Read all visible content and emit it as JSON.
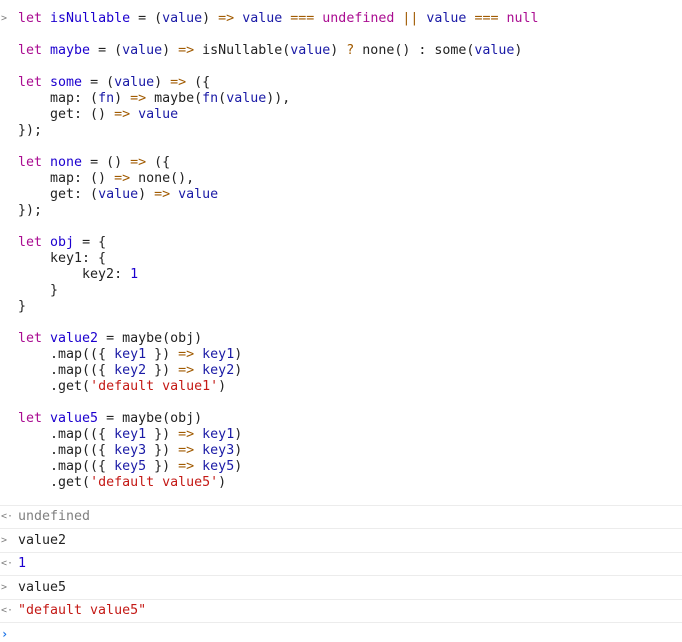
{
  "console": {
    "input_block": {
      "lines": [
        [
          [
            "kw",
            "let "
          ],
          [
            "var",
            "isNullable"
          ],
          [
            "plain",
            " = ("
          ],
          [
            "varb",
            "value"
          ],
          [
            "plain",
            ") "
          ],
          [
            "op",
            "=>"
          ],
          [
            "plain",
            " "
          ],
          [
            "varb",
            "value"
          ],
          [
            "plain",
            " "
          ],
          [
            "op",
            "==="
          ],
          [
            "plain",
            " "
          ],
          [
            "kw",
            "undefined"
          ],
          [
            "plain",
            " "
          ],
          [
            "op",
            "||"
          ],
          [
            "plain",
            " "
          ],
          [
            "varb",
            "value"
          ],
          [
            "plain",
            " "
          ],
          [
            "op",
            "==="
          ],
          [
            "plain",
            " "
          ],
          [
            "kw",
            "null"
          ]
        ],
        [],
        [
          [
            "kw",
            "let "
          ],
          [
            "var",
            "maybe"
          ],
          [
            "plain",
            " = ("
          ],
          [
            "varb",
            "value"
          ],
          [
            "plain",
            ") "
          ],
          [
            "op",
            "=>"
          ],
          [
            "plain",
            " isNullable("
          ],
          [
            "varb",
            "value"
          ],
          [
            "plain",
            ") "
          ],
          [
            "op",
            "?"
          ],
          [
            "plain",
            " none() : some("
          ],
          [
            "varb",
            "value"
          ],
          [
            "plain",
            ")"
          ]
        ],
        [],
        [
          [
            "kw",
            "let "
          ],
          [
            "var",
            "some"
          ],
          [
            "plain",
            " = ("
          ],
          [
            "varb",
            "value"
          ],
          [
            "plain",
            ") "
          ],
          [
            "op",
            "=>"
          ],
          [
            "plain",
            " ({"
          ]
        ],
        [
          [
            "plain",
            "    map: ("
          ],
          [
            "varb",
            "fn"
          ],
          [
            "plain",
            ") "
          ],
          [
            "op",
            "=>"
          ],
          [
            "plain",
            " maybe("
          ],
          [
            "varb",
            "fn"
          ],
          [
            "plain",
            "("
          ],
          [
            "varb",
            "value"
          ],
          [
            "plain",
            ")),"
          ]
        ],
        [
          [
            "plain",
            "    get: () "
          ],
          [
            "op",
            "=>"
          ],
          [
            "plain",
            " "
          ],
          [
            "varb",
            "value"
          ]
        ],
        [
          [
            "plain",
            "});"
          ]
        ],
        [],
        [
          [
            "kw",
            "let "
          ],
          [
            "var",
            "none"
          ],
          [
            "plain",
            " = () "
          ],
          [
            "op",
            "=>"
          ],
          [
            "plain",
            " ({"
          ]
        ],
        [
          [
            "plain",
            "    map: () "
          ],
          [
            "op",
            "=>"
          ],
          [
            "plain",
            " none(),"
          ]
        ],
        [
          [
            "plain",
            "    get: ("
          ],
          [
            "varb",
            "value"
          ],
          [
            "plain",
            ") "
          ],
          [
            "op",
            "=>"
          ],
          [
            "plain",
            " "
          ],
          [
            "varb",
            "value"
          ]
        ],
        [
          [
            "plain",
            "});"
          ]
        ],
        [],
        [
          [
            "kw",
            "let "
          ],
          [
            "var",
            "obj"
          ],
          [
            "plain",
            " = {"
          ]
        ],
        [
          [
            "plain",
            "    key1: {"
          ]
        ],
        [
          [
            "plain",
            "        key2: "
          ],
          [
            "num",
            "1"
          ]
        ],
        [
          [
            "plain",
            "    }"
          ]
        ],
        [
          [
            "plain",
            "}"
          ]
        ],
        [],
        [
          [
            "kw",
            "let "
          ],
          [
            "var",
            "value2"
          ],
          [
            "plain",
            " = maybe(obj)"
          ]
        ],
        [
          [
            "plain",
            "    .map(({ "
          ],
          [
            "varb",
            "key1"
          ],
          [
            "plain",
            " }) "
          ],
          [
            "op",
            "=>"
          ],
          [
            "plain",
            " "
          ],
          [
            "varb",
            "key1"
          ],
          [
            "plain",
            ")"
          ]
        ],
        [
          [
            "plain",
            "    .map(({ "
          ],
          [
            "varb",
            "key2"
          ],
          [
            "plain",
            " }) "
          ],
          [
            "op",
            "=>"
          ],
          [
            "plain",
            " "
          ],
          [
            "varb",
            "key2"
          ],
          [
            "plain",
            ")"
          ]
        ],
        [
          [
            "plain",
            "    .get("
          ],
          [
            "str",
            "'default value1'"
          ],
          [
            "plain",
            ")"
          ]
        ],
        [],
        [
          [
            "kw",
            "let "
          ],
          [
            "var",
            "value5"
          ],
          [
            "plain",
            " = maybe(obj)"
          ]
        ],
        [
          [
            "plain",
            "    .map(({ "
          ],
          [
            "varb",
            "key1"
          ],
          [
            "plain",
            " }) "
          ],
          [
            "op",
            "=>"
          ],
          [
            "plain",
            " "
          ],
          [
            "varb",
            "key1"
          ],
          [
            "plain",
            ")"
          ]
        ],
        [
          [
            "plain",
            "    .map(({ "
          ],
          [
            "varb",
            "key3"
          ],
          [
            "plain",
            " }) "
          ],
          [
            "op",
            "=>"
          ],
          [
            "plain",
            " "
          ],
          [
            "varb",
            "key3"
          ],
          [
            "plain",
            ")"
          ]
        ],
        [
          [
            "plain",
            "    .map(({ "
          ],
          [
            "varb",
            "key5"
          ],
          [
            "plain",
            " }) "
          ],
          [
            "op",
            "=>"
          ],
          [
            "plain",
            " "
          ],
          [
            "varb",
            "key5"
          ],
          [
            "plain",
            ")"
          ]
        ],
        [
          [
            "plain",
            "    .get("
          ],
          [
            "str",
            "'default value5'"
          ],
          [
            "plain",
            ")"
          ]
        ]
      ]
    },
    "result1": "undefined",
    "input2": "value2",
    "result2": "1",
    "input3": "value5",
    "result3": "\"default value5\"",
    "icons": {
      "input_prompt": "chevron-right-icon",
      "output_prompt": "return-arrow-icon",
      "active_prompt": "chevron-right-icon"
    },
    "colors": {
      "keyword": "#aa0d91",
      "variable": "#1c00cf",
      "string": "#c41a16",
      "operator": "#a05a00",
      "prompt": "#1a73e8"
    }
  }
}
